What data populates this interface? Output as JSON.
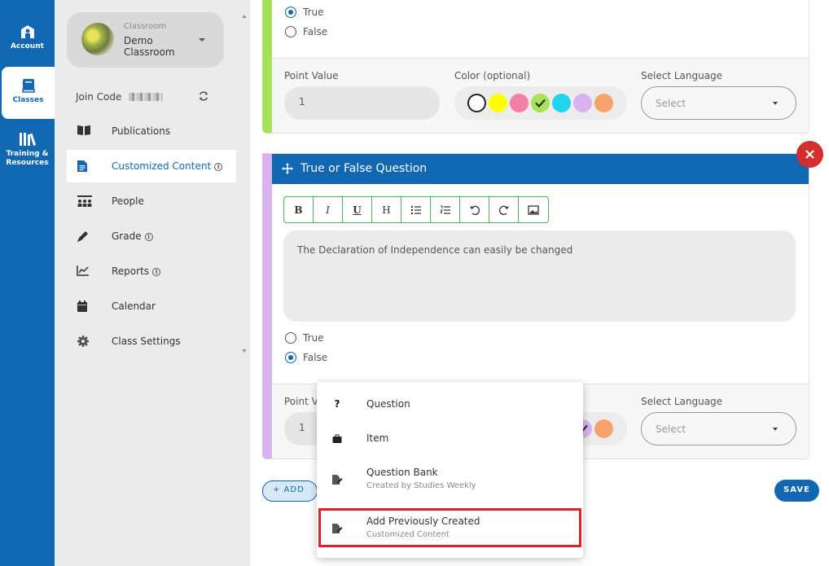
{
  "rail": {
    "items": [
      {
        "label": "Account",
        "icon": "account-icon"
      },
      {
        "label": "Classes",
        "icon": "book-icon"
      },
      {
        "label": "Training & Resources",
        "icon": "library-icon"
      }
    ]
  },
  "sidebar": {
    "classroom_label": "Classroom",
    "classroom_name": "Demo Classroom",
    "join_code_label": "Join Code",
    "nav": [
      {
        "label": "Publications",
        "icon": "open-book-icon",
        "info": false
      },
      {
        "label": "Customized Content",
        "icon": "document-icon",
        "info": true
      },
      {
        "label": "People",
        "icon": "people-icon",
        "info": false
      },
      {
        "label": "Grade",
        "icon": "pencil-icon",
        "info": true
      },
      {
        "label": "Reports",
        "icon": "chart-line-icon",
        "info": true
      },
      {
        "label": "Calendar",
        "icon": "calendar-icon",
        "info": false
      },
      {
        "label": "Class Settings",
        "icon": "gear-icon",
        "info": false
      }
    ],
    "active_index": 1
  },
  "card1": {
    "options": [
      "True",
      "False"
    ],
    "selected": "True",
    "point_label": "Point Value",
    "point_value": "1",
    "color_label": "Color (optional)",
    "language_label": "Select Language",
    "language_placeholder": "Select",
    "colors": [
      "#ffffff",
      "#ffff00",
      "#f27fa5",
      "#a7e25a",
      "#22d3ee",
      "#d8b3ee",
      "#f6a26a"
    ],
    "selected_color": "#a7e25a"
  },
  "card2": {
    "title": "True or False Question",
    "toolbar": [
      "B",
      "I",
      "U",
      "H",
      "bullet-list",
      "numbered-list",
      "undo",
      "redo",
      "image"
    ],
    "question_text": "The Declaration of Independence can easily be changed",
    "options": [
      "True",
      "False"
    ],
    "selected": "False",
    "point_label": "Point V",
    "point_value": "1",
    "language_label": "Select Language",
    "language_placeholder": "Select"
  },
  "actions": {
    "add_label": "+ ADD",
    "save_label": "SAVE"
  },
  "menu": {
    "items": [
      {
        "title": "Question",
        "subtitle": "",
        "icon": "question-icon"
      },
      {
        "title": "Item",
        "subtitle": "",
        "icon": "briefcase-icon"
      },
      {
        "title": "Question Bank",
        "subtitle": "Created by Studies Weekly",
        "icon": "edit-file-icon"
      },
      {
        "title": "Add Previously Created",
        "subtitle": "Customized Content",
        "icon": "edit-file-icon"
      }
    ],
    "highlighted_index": 3
  }
}
